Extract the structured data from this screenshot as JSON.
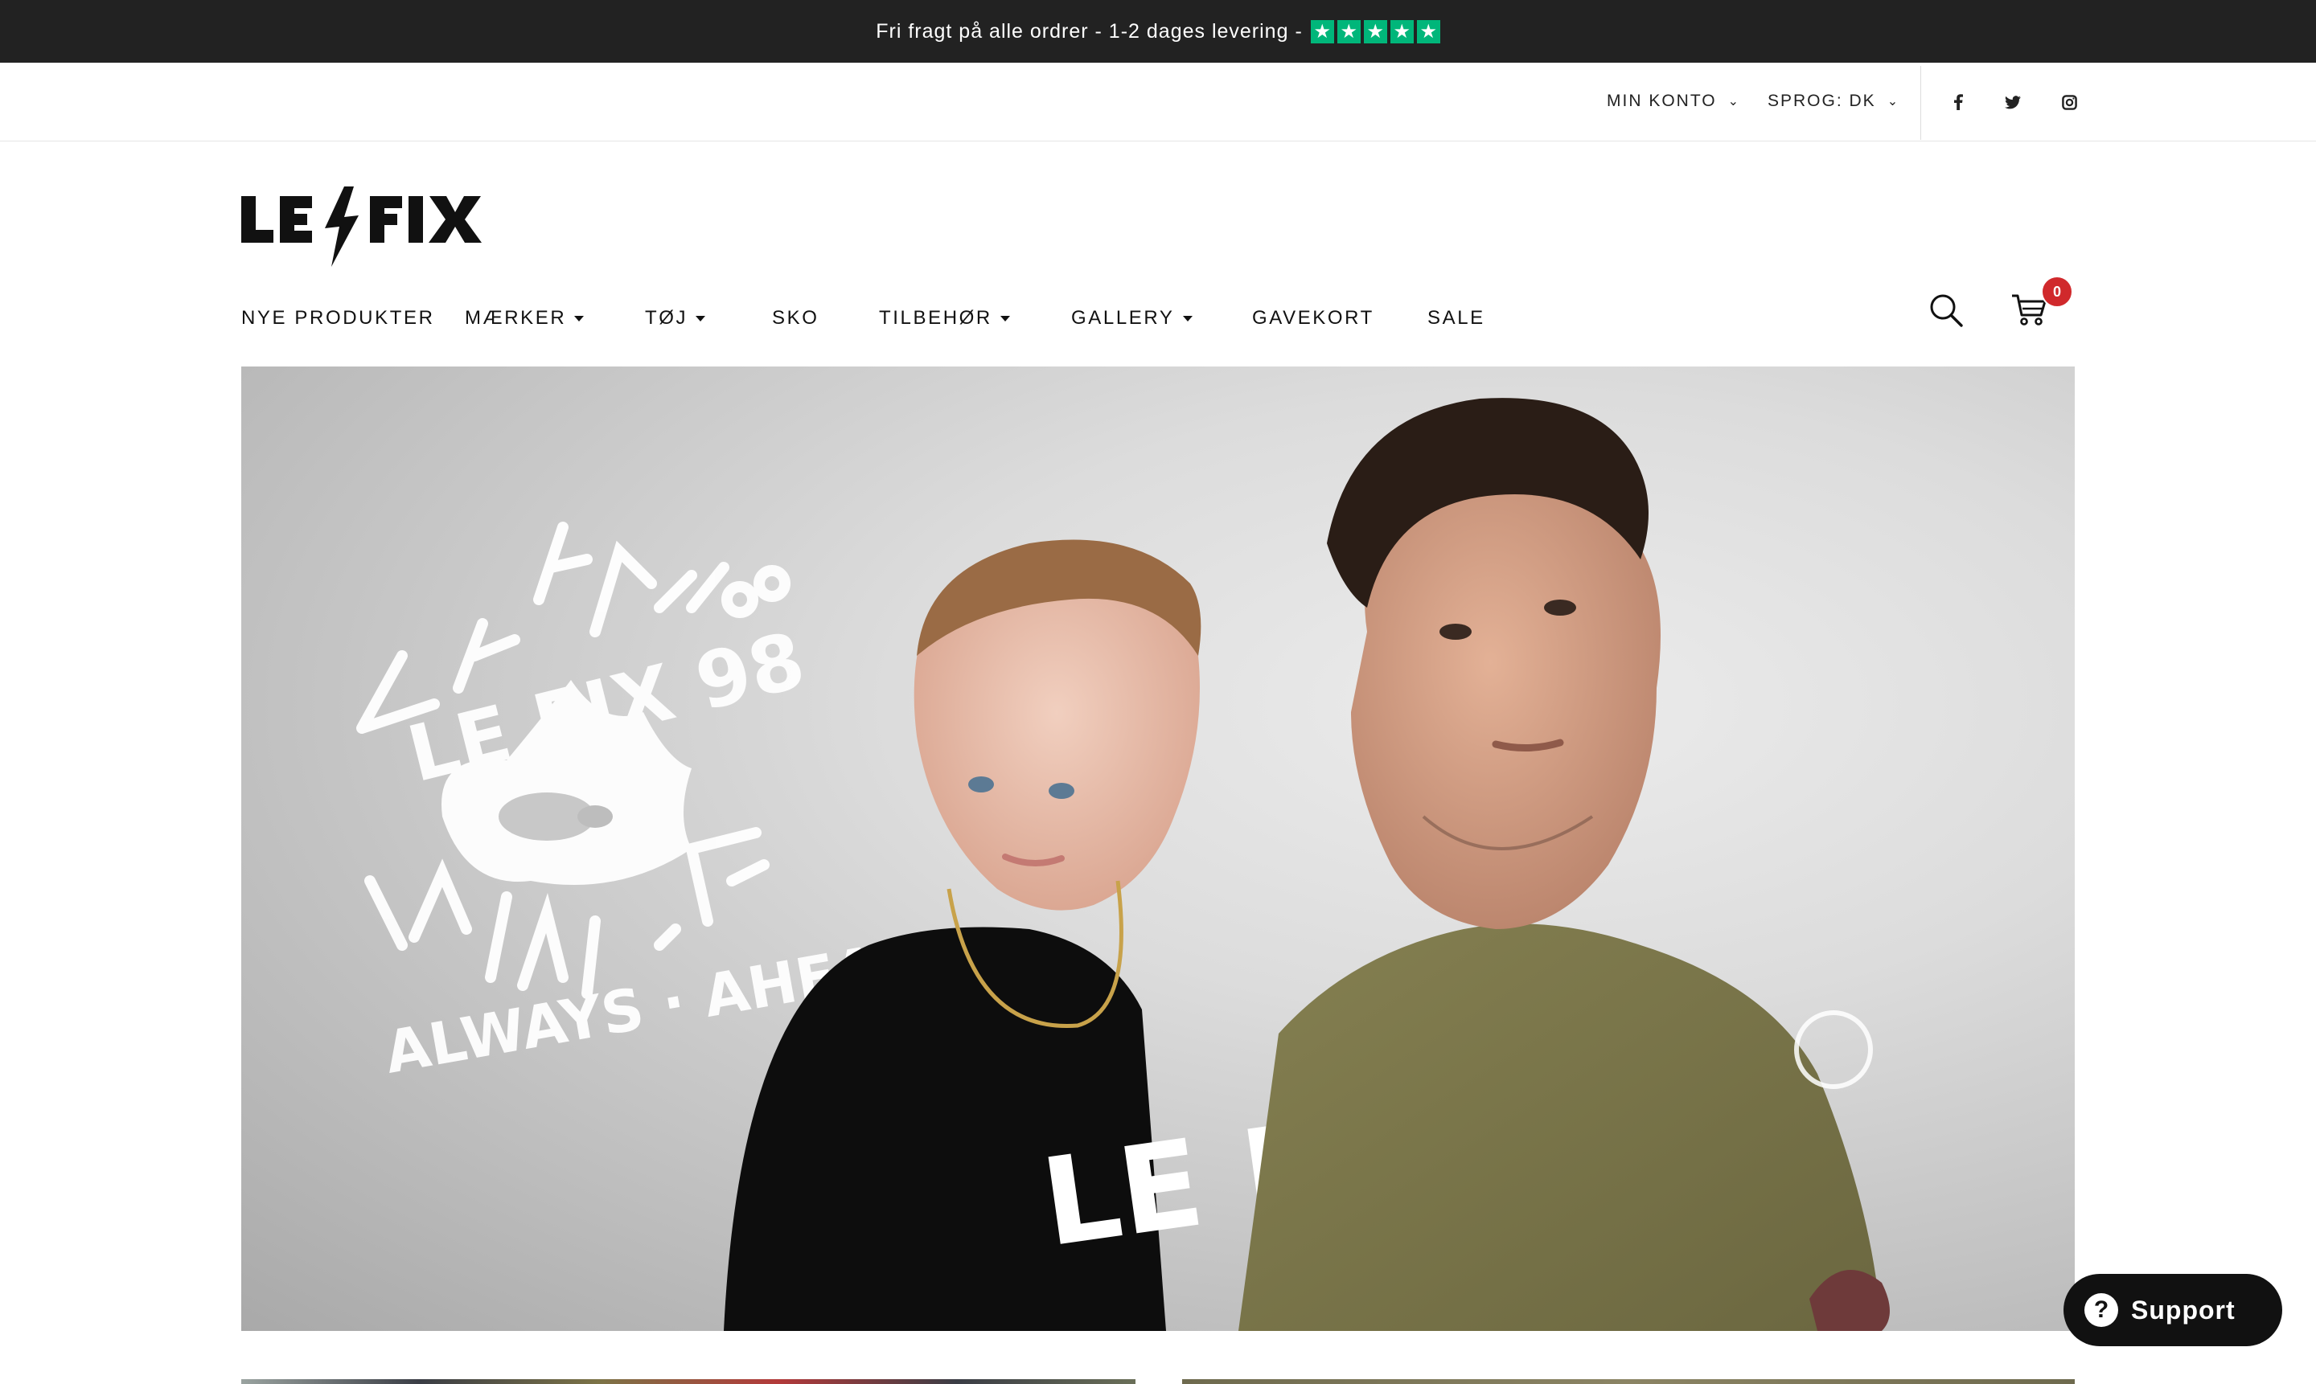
{
  "announcement": {
    "text": "Fri fragt på alle ordrer - 1-2 dages levering -",
    "stars": [
      "★",
      "★",
      "★",
      "★",
      "★"
    ],
    "star_color": "#00b67a"
  },
  "utility": {
    "account_label": "MIN KONTO",
    "language_label": "SPROG: DK",
    "social": [
      "facebook-icon",
      "twitter-icon",
      "instagram-icon"
    ]
  },
  "brand": {
    "logo_text": "LE FIX"
  },
  "nav": {
    "items": [
      {
        "label": "NYE PRODUKTER",
        "has_dropdown": false
      },
      {
        "label": "MÆRKER",
        "has_dropdown": true
      },
      {
        "label": "TØJ",
        "has_dropdown": true
      },
      {
        "label": "SKO",
        "has_dropdown": false
      },
      {
        "label": "TILBEHØR",
        "has_dropdown": true
      },
      {
        "label": "GALLERY",
        "has_dropdown": true
      },
      {
        "label": "GAVEKORT",
        "has_dropdown": false
      },
      {
        "label": "SALE",
        "has_dropdown": false
      }
    ]
  },
  "cart": {
    "count": "0",
    "badge_color": "#d0292c"
  },
  "hero": {
    "graphic_text_top": "LE FIX 98",
    "graphic_text_bottom": "ALWAYS · AHEAD",
    "shirt_text": "LE FIX"
  },
  "support": {
    "label": "Support",
    "icon": "?"
  }
}
